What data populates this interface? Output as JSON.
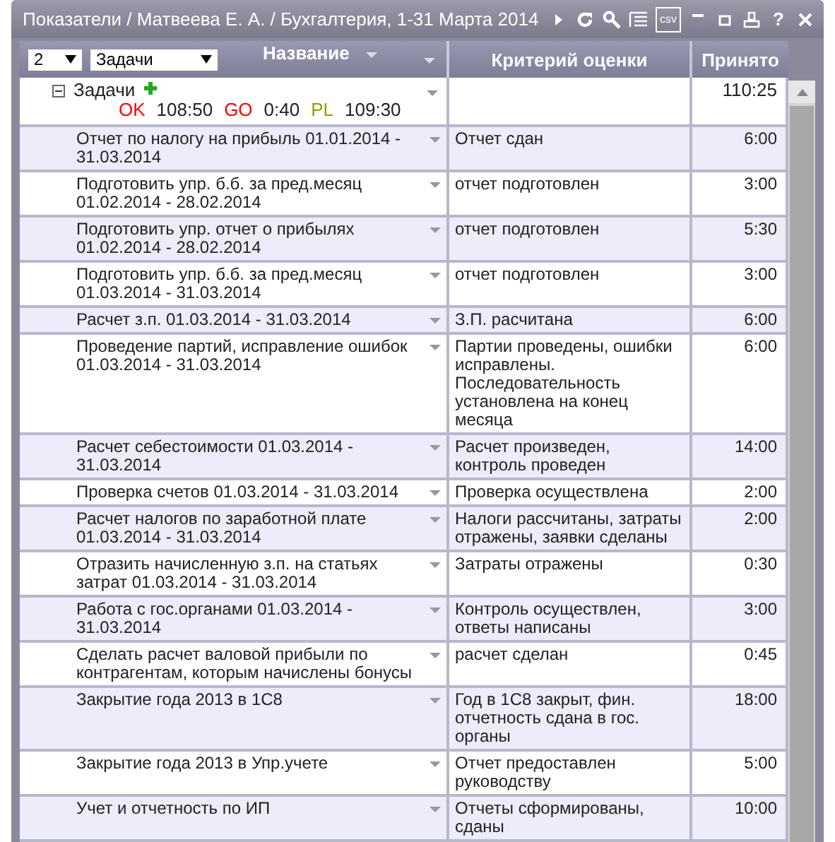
{
  "window": {
    "title": "Показатели / Матвеева Е. А. / Бухгалтерия, 1-31 Марта 2014",
    "icons": [
      {
        "kind": "play"
      },
      {
        "kind": "refresh"
      },
      {
        "kind": "search"
      },
      {
        "kind": "list"
      },
      {
        "kind": "csv",
        "label": "csv"
      },
      {
        "kind": "minimize"
      },
      {
        "kind": "maximize"
      },
      {
        "kind": "print"
      },
      {
        "kind": "help",
        "label": "?"
      },
      {
        "kind": "close"
      }
    ]
  },
  "header": {
    "level_select": "2",
    "group_select": "Задачи",
    "columns": [
      "Название",
      "Критерий оценки",
      "Принято"
    ]
  },
  "group": {
    "name": "Задачи",
    "expanded": true,
    "stats": [
      {
        "label": "OK",
        "value": "108:50",
        "color": "#ff0000"
      },
      {
        "label": "GO",
        "value": "0:40",
        "color": "#ff0000"
      },
      {
        "label": "PL",
        "value": "109:30",
        "color": "#999900"
      }
    ],
    "taken": "110:25"
  },
  "rows": [
    {
      "name": "Отчет по налогу на прибыль 01.01.2014 - 31.03.2014",
      "criterion": "Отчет сдан",
      "taken": "6:00"
    },
    {
      "name": "Подготовить упр. б.б. за пред.месяц 01.02.2014 - 28.02.2014",
      "criterion": "отчет подготовлен",
      "taken": "3:00"
    },
    {
      "name": "Подготовить упр. отчет о прибылях 01.02.2014 - 28.02.2014",
      "criterion": "отчет подготовлен",
      "taken": "5:30"
    },
    {
      "name": "Подготовить упр. б.б. за пред.месяц 01.03.2014 - 31.03.2014",
      "criterion": "отчет подготовлен",
      "taken": "3:00"
    },
    {
      "name": "Расчет з.п. 01.03.2014 - 31.03.2014",
      "criterion": "З.П. расчитана",
      "taken": "6:00"
    },
    {
      "name": "Проведение партий, исправление ошибок 01.03.2014 - 31.03.2014",
      "criterion": "Партии проведены, ошибки исправлены. Последовательность установлена на конец месяца",
      "taken": "6:00"
    },
    {
      "name": "Расчет себестоимости 01.03.2014 - 31.03.2014",
      "criterion": "Расчет произведен, контроль проведен",
      "taken": "14:00"
    },
    {
      "name": "Проверка счетов 01.03.2014 - 31.03.2014",
      "criterion": "Проверка осуществлена",
      "taken": "2:00"
    },
    {
      "name": "Расчет налогов по заработной плате 01.03.2014 - 31.03.2014",
      "criterion": "Налоги рассчитаны, затраты отражены, заявки сделаны",
      "taken": "2:00"
    },
    {
      "name": "Отразить начисленную з.п. на статьях затрат 01.03.2014 - 31.03.2014",
      "criterion": "Затраты отражены",
      "taken": "0:30"
    },
    {
      "name": "Работа с гос.органами 01.03.2014 - 31.03.2014",
      "criterion": "Контроль осуществлен, ответы написаны",
      "taken": "3:00"
    },
    {
      "name": "Сделать расчет валовой прибыли по контрагентам, которым начислены бонусы",
      "criterion": "расчет сделан",
      "taken": "0:45"
    },
    {
      "name": "Закрытие года 2013 в 1С8",
      "criterion": "Год в 1С8 закрыт, фин. отчетность сдана в гос. органы",
      "taken": "18:00"
    },
    {
      "name": "Закрытие года 2013 в Упр.учете",
      "criterion": "Отчет предоставлен руководству",
      "taken": "5:00"
    },
    {
      "name": "Учет и отчетность по ИП",
      "criterion": "Отчеты сформированы, сданы",
      "taken": "10:00"
    }
  ]
}
